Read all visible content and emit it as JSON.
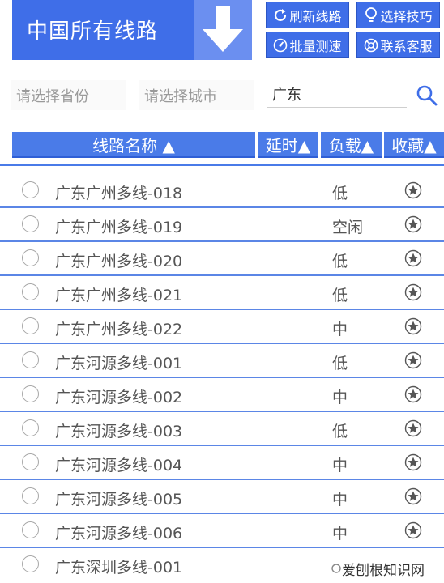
{
  "header": {
    "title": "中国所有线路"
  },
  "toolbar": {
    "refresh_label": "刷新线路",
    "tips_label": "选择技巧",
    "speedtest_label": "批量测速",
    "support_label": "联系客服"
  },
  "filters": {
    "province_placeholder": "请选择省份",
    "city_placeholder": "请选择城市",
    "keyword_value": "广东"
  },
  "table": {
    "columns": [
      "线路名称 ▲",
      "延时▲",
      "负载▲",
      "收藏▲"
    ],
    "rows": [
      {
        "name": "广东广州多线-018",
        "load": "低"
      },
      {
        "name": "广东广州多线-019",
        "load": "空闲"
      },
      {
        "name": "广东广州多线-020",
        "load": "低"
      },
      {
        "name": "广东广州多线-021",
        "load": "低"
      },
      {
        "name": "广东广州多线-022",
        "load": "中"
      },
      {
        "name": "广东河源多线-001",
        "load": "低"
      },
      {
        "name": "广东河源多线-002",
        "load": "中"
      },
      {
        "name": "广东河源多线-003",
        "load": "低"
      },
      {
        "name": "广东河源多线-004",
        "load": "中"
      },
      {
        "name": "广东河源多线-005",
        "load": "中"
      },
      {
        "name": "广东河源多线-006",
        "load": "中"
      },
      {
        "name": "广东深圳多线-001",
        "load": ""
      }
    ]
  },
  "watermark": {
    "text": "爱刨根知识网"
  },
  "colors": {
    "primary": "#3f6ee8",
    "header_light": "#6b8ff0",
    "row_border": "#5b86e6"
  }
}
